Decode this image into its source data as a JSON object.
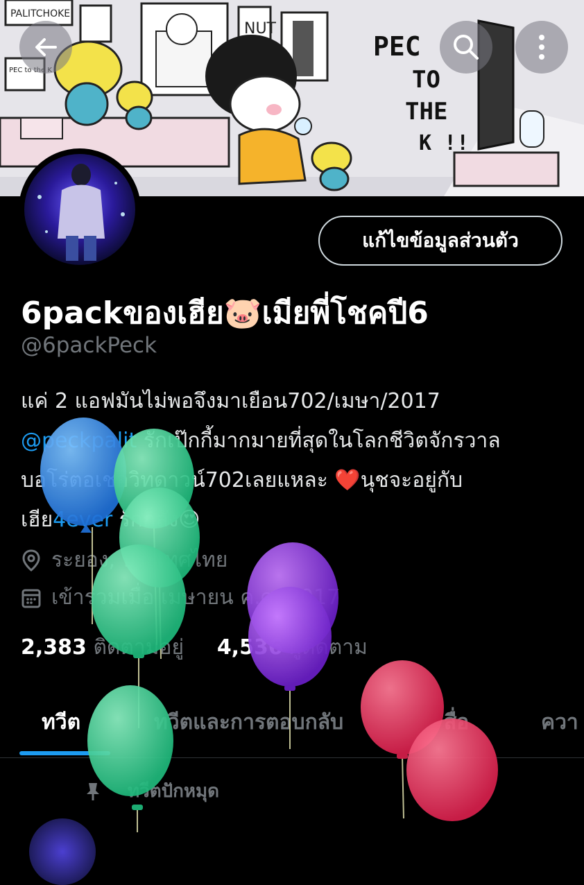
{
  "banner": {
    "wall_labels": [
      "PALITCHOKE",
      "PEC to the K",
      "NUT"
    ],
    "slogan": [
      "PEC",
      "TO",
      "THE",
      "K !!"
    ]
  },
  "header": {
    "back_icon": "arrow-left-icon",
    "search_icon": "search-icon",
    "more_icon": "more-vertical-icon"
  },
  "profile": {
    "edit_label": "แก้ไขข้อมูลส่วนตัว",
    "name": "6packของเฮีย🐷เมียพี่โชคปี6",
    "handle": "@6packPeck",
    "bio_line1": "แค่ 2 แอฟมันไม่พอจึงมาเยือน702/เมษา/2017",
    "bio_mention": "@peckpalit",
    "bio_line2_rest": " รักเป๊กกี้มากมายที่สุดในโลกชีวิตจักรวาล",
    "bio_line3": "บอโร่ตอเชอวิทดาวน์702เลยแหละ ❤️นุชจะอยู่กับ",
    "bio_line4_a": "เฮีย",
    "bio_line4_link": "4ever",
    "bio_line4_b": " รักก็ลัง😍",
    "location": "ระยอง, ประเทศไทย",
    "joined": "เข้าร่วมเมื่อ เมษายน ค.ศ. 2017",
    "following_count": "2,383",
    "following_label": "ติดตามอยู่",
    "followers_count": "4,536",
    "followers_label": "ผู้ติดตาม"
  },
  "tabs": [
    {
      "label": "ทวีต"
    },
    {
      "label": "ทวีตและการตอบกลับ"
    },
    {
      "label": "สื่อ"
    },
    {
      "label": "ควา"
    }
  ],
  "pinned": {
    "label": "ทวีตปักหมุด"
  },
  "colors": {
    "accent": "#1d9bf0",
    "background": "#000000"
  }
}
